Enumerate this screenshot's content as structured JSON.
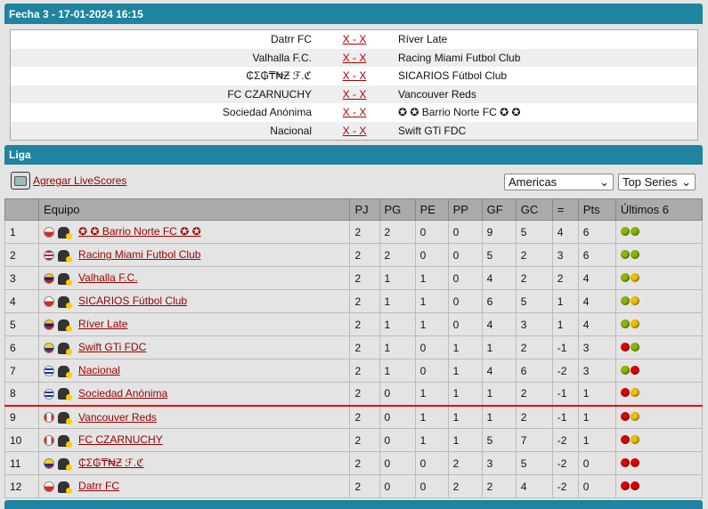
{
  "header": {
    "title": "Fecha 3 - 17-01-2024 16:15"
  },
  "matches": [
    {
      "home": "Datrr FC",
      "score": "X - X",
      "away": "Ríver Late"
    },
    {
      "home": "Valhalla F.C.",
      "score": "X - X",
      "away": "Racing Miami Futbol Club"
    },
    {
      "home": "₵Σ₲₸₦Ƶ ℱ.ℭ",
      "score": "X - X",
      "away": "SICARIOS Fútbol Club"
    },
    {
      "home": "FC CZARNUCHY",
      "score": "X - X",
      "away": "Vancouver Reds"
    },
    {
      "home": "Sociedad Anónima",
      "score": "X - X",
      "away": "✪ ✪ Barrio Norte FC ✪ ✪"
    },
    {
      "home": "Nacional",
      "score": "X - X",
      "away": "Swift GTi FDC"
    }
  ],
  "liga": {
    "title": "Liga",
    "livescores_link": "Agregar LiveScores",
    "region_select": "Americas",
    "series_select": "Top Series"
  },
  "table": {
    "headers": [
      "",
      "Equipo",
      "PJ",
      "PG",
      "PE",
      "PP",
      "GF",
      "GC",
      "=",
      "Pts",
      "Últimos 6"
    ],
    "rows": [
      {
        "pos": "1",
        "flag": "chile",
        "team": "✪ ✪ Barrio Norte FC ✪ ✪",
        "pj": "2",
        "pg": "2",
        "pe": "0",
        "pp": "0",
        "gf": "9",
        "gc": "5",
        "dif": "4",
        "pts": "6",
        "last": [
          "green",
          "green"
        ]
      },
      {
        "pos": "2",
        "flag": "usa",
        "team": "Racing Miami Futbol Club",
        "pj": "2",
        "pg": "2",
        "pe": "0",
        "pp": "0",
        "gf": "5",
        "gc": "2",
        "dif": "3",
        "pts": "6",
        "last": [
          "green",
          "green"
        ]
      },
      {
        "pos": "3",
        "flag": "venezuela",
        "team": "Valhalla F.C.",
        "pj": "2",
        "pg": "1",
        "pe": "1",
        "pp": "0",
        "gf": "4",
        "gc": "2",
        "dif": "2",
        "pts": "4",
        "last": [
          "green",
          "yellow"
        ]
      },
      {
        "pos": "4",
        "flag": "chile",
        "team": "SICARIOS Fútbol Club",
        "pj": "2",
        "pg": "1",
        "pe": "1",
        "pp": "0",
        "gf": "6",
        "gc": "5",
        "dif": "1",
        "pts": "4",
        "last": [
          "green",
          "yellow"
        ]
      },
      {
        "pos": "5",
        "flag": "venezuela",
        "team": "Ríver Late",
        "pj": "2",
        "pg": "1",
        "pe": "1",
        "pp": "0",
        "gf": "4",
        "gc": "3",
        "dif": "1",
        "pts": "4",
        "last": [
          "green",
          "yellow"
        ]
      },
      {
        "pos": "6",
        "flag": "colombia",
        "team": "Swift GTi FDC",
        "pj": "2",
        "pg": "1",
        "pe": "0",
        "pp": "1",
        "gf": "1",
        "gc": "2",
        "dif": "-1",
        "pts": "3",
        "last": [
          "red",
          "green"
        ]
      },
      {
        "pos": "7",
        "flag": "uruguay",
        "team": "Nacional",
        "pj": "2",
        "pg": "1",
        "pe": "0",
        "pp": "1",
        "gf": "4",
        "gc": "6",
        "dif": "-2",
        "pts": "3",
        "last": [
          "green",
          "red"
        ]
      },
      {
        "pos": "8",
        "flag": "uruguay",
        "team": "Sociedad Anónima",
        "pj": "2",
        "pg": "0",
        "pe": "1",
        "pp": "1",
        "gf": "1",
        "gc": "2",
        "dif": "-1",
        "pts": "1",
        "last": [
          "red",
          "yellow"
        ]
      },
      {
        "pos": "9",
        "flag": "canada",
        "team": "Vancouver Reds",
        "pj": "2",
        "pg": "0",
        "pe": "1",
        "pp": "1",
        "gf": "1",
        "gc": "2",
        "dif": "-1",
        "pts": "1",
        "last": [
          "red",
          "yellow"
        ]
      },
      {
        "pos": "10",
        "flag": "canada",
        "team": "FC CZARNUCHY",
        "pj": "2",
        "pg": "0",
        "pe": "1",
        "pp": "1",
        "gf": "5",
        "gc": "7",
        "dif": "-2",
        "pts": "1",
        "last": [
          "red",
          "yellow"
        ]
      },
      {
        "pos": "11",
        "flag": "colombia",
        "team": "₵Σ₲₸₦Ƶ ℱ.ℭ",
        "pj": "2",
        "pg": "0",
        "pe": "0",
        "pp": "2",
        "gf": "3",
        "gc": "5",
        "dif": "-2",
        "pts": "0",
        "last": [
          "red",
          "red"
        ]
      },
      {
        "pos": "12",
        "flag": "chile",
        "team": "Datrr FC",
        "pj": "2",
        "pg": "0",
        "pe": "0",
        "pp": "2",
        "gf": "2",
        "gc": "4",
        "dif": "-2",
        "pts": "0",
        "last": [
          "red",
          "red"
        ]
      }
    ]
  },
  "colors": {
    "accent": "#1e84a0",
    "link": "#990000",
    "separator": "#ee0000",
    "green": "#8ab800",
    "yellow": "#f0c000",
    "red": "#e00000"
  }
}
